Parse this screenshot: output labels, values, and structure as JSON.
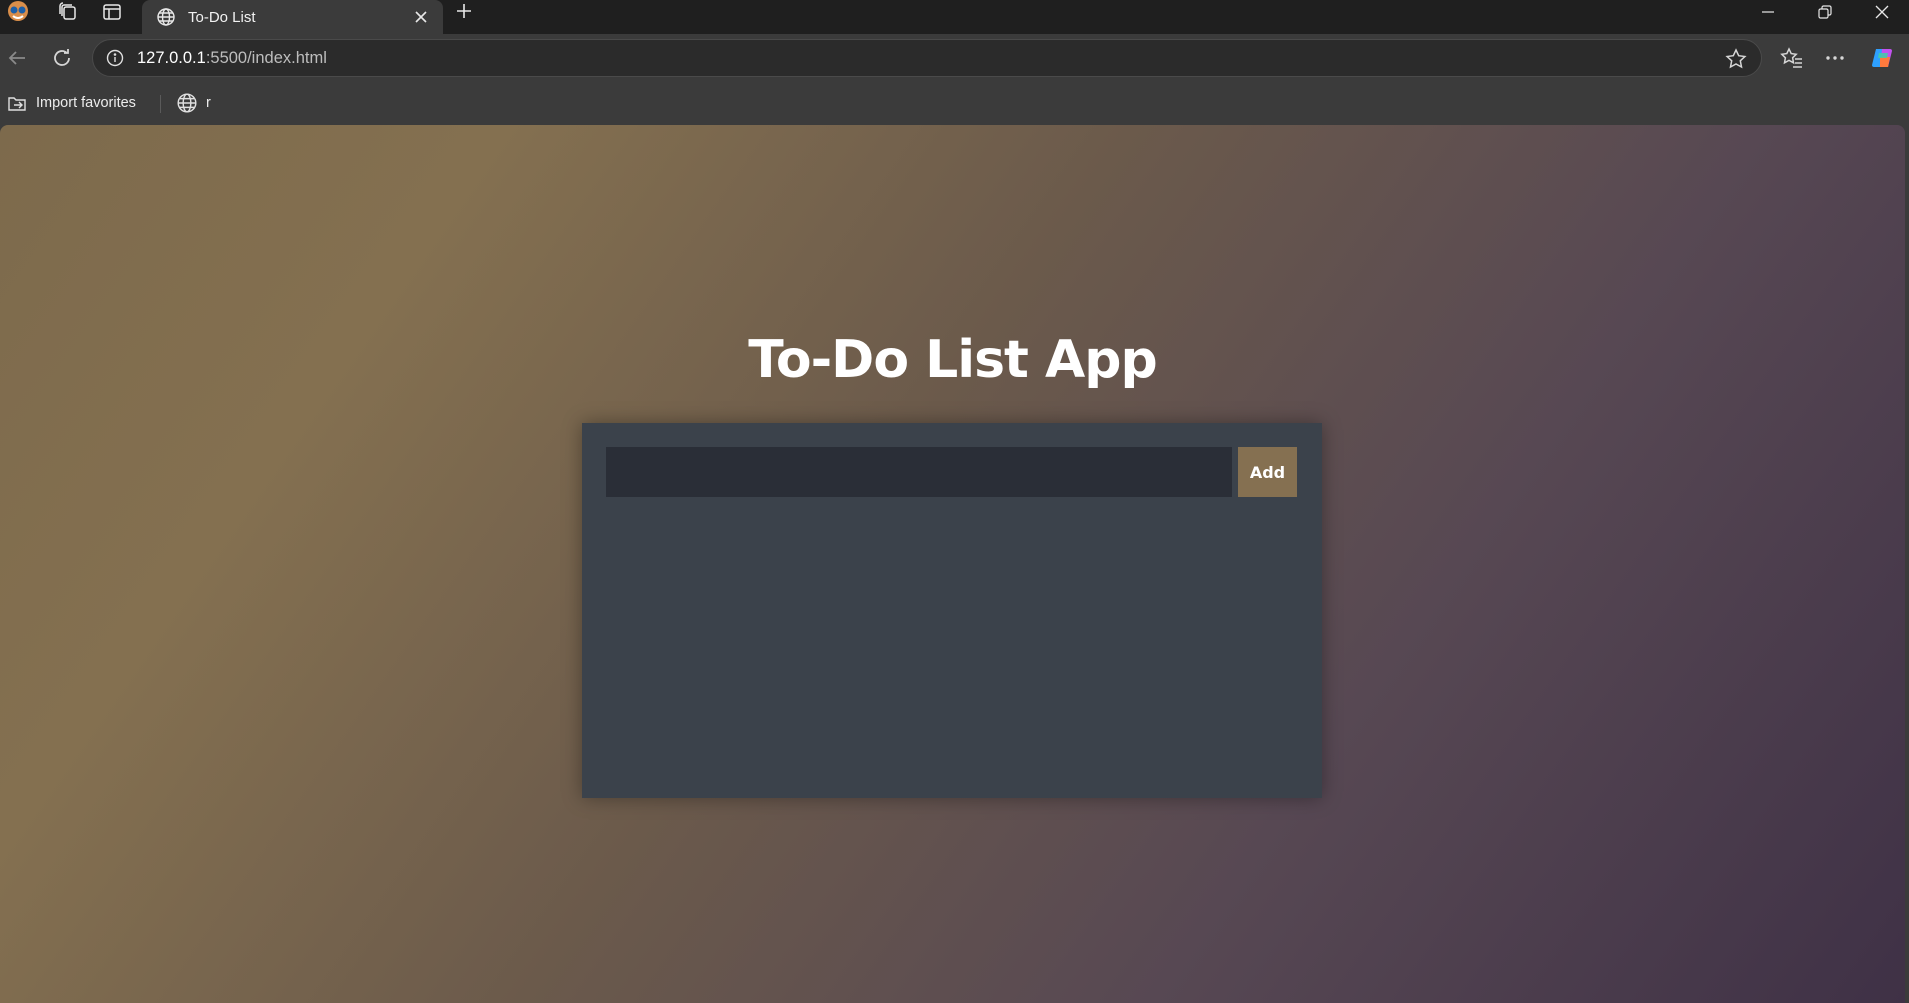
{
  "browser": {
    "tab": {
      "title": "To-Do List",
      "favicon": "globe-icon"
    },
    "address": {
      "host": "127.0.0.1",
      "rest": ":5500/index.html"
    },
    "favorites": [
      {
        "label": "Import favorites",
        "icon": "import-favorites-icon"
      },
      {
        "label": "r",
        "icon": "globe-icon"
      }
    ]
  },
  "app": {
    "title": "To-Do List App",
    "input": {
      "value": "",
      "placeholder": ""
    },
    "add_label": "Add",
    "tasks": []
  },
  "colors": {
    "gradient_start": "#847050",
    "gradient_end": "#3f3146",
    "card": "#3b424b",
    "input": "#2a2e37",
    "add_button": "#857051"
  }
}
